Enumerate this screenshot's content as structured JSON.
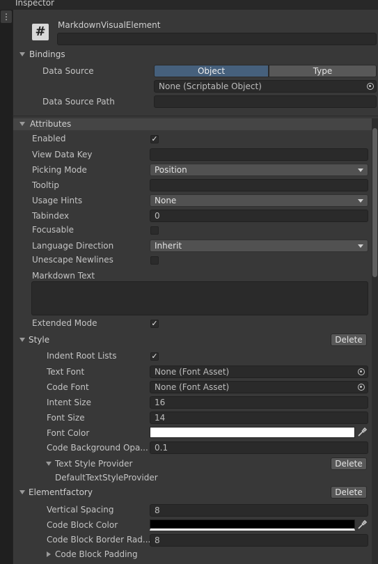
{
  "window": {
    "title": "Inspector"
  },
  "component": {
    "name": "MarkdownVisualElement",
    "name_field_value": ""
  },
  "bindings": {
    "header": "Bindings",
    "data_source_label": "Data Source",
    "tab_object": "Object",
    "tab_type": "Type",
    "object_field_value": "None (Scriptable Object)",
    "data_source_path_label": "Data Source Path",
    "data_source_path_value": ""
  },
  "attributes": {
    "header": "Attributes",
    "enabled_label": "Enabled",
    "enabled": true,
    "view_data_key_label": "View Data Key",
    "view_data_key_value": "",
    "picking_mode_label": "Picking Mode",
    "picking_mode_value": "Position",
    "tooltip_label": "Tooltip",
    "tooltip_value": "",
    "usage_hints_label": "Usage Hints",
    "usage_hints_value": "None",
    "tabindex_label": "Tabindex",
    "tabindex_value": "0",
    "focusable_label": "Focusable",
    "focusable": false,
    "language_direction_label": "Language Direction",
    "language_direction_value": "Inherit",
    "unescape_newlines_label": "Unescape Newlines",
    "unescape_newlines": false,
    "markdown_text_label": "Markdown Text",
    "markdown_text_value": "",
    "extended_mode_label": "Extended Mode",
    "extended_mode": true
  },
  "style": {
    "header": "Style",
    "delete_label": "Delete",
    "indent_root_lists_label": "Indent Root Lists",
    "indent_root_lists": true,
    "text_font_label": "Text Font",
    "text_font_value": "None (Font Asset)",
    "code_font_label": "Code Font",
    "code_font_value": "None (Font Asset)",
    "intent_size_label": "Intent Size",
    "intent_size_value": "16",
    "font_size_label": "Font Size",
    "font_size_value": "14",
    "font_color_label": "Font Color",
    "font_color_value": "#ffffff",
    "code_bg_opacity_label": "Code Background Opa...",
    "code_bg_opacity_value": "0.1",
    "text_style_provider_header": "Text Style Provider",
    "text_style_provider_delete": "Delete",
    "text_style_provider_value": "DefaultTextStyleProvider"
  },
  "element_factory": {
    "header": "Elementfactory",
    "delete_label": "Delete",
    "vertical_spacing_label": "Vertical Spacing",
    "vertical_spacing_value": "8",
    "code_block_color_label": "Code Block Color",
    "code_block_color_value": "#000000",
    "code_block_border_radius_label": "Code Block Border Rad...",
    "code_block_border_radius_value": "8",
    "code_block_padding_label": "Code Block Padding"
  },
  "icons": {
    "component_icon": "hash-icon",
    "object_picker": "object-picker-icon",
    "eyedropper": "eyedropper-icon",
    "kebab": "kebab-menu-icon"
  },
  "colors": {
    "background": "#383838",
    "selected_tab": "#46607c",
    "field_background": "#2a2a2a",
    "dropdown_background": "#515151"
  }
}
